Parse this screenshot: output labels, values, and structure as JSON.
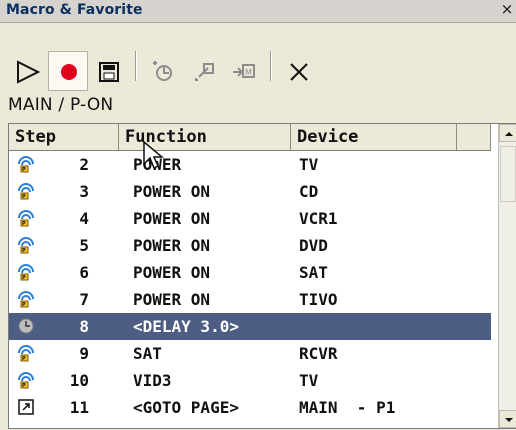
{
  "window": {
    "title": "Macro & Favorite",
    "close_label": "×"
  },
  "path": {
    "label": "MAIN / P-ON"
  },
  "table": {
    "headers": {
      "step": "Step",
      "function": "Function",
      "device": "Device"
    },
    "rows": [
      {
        "icon": "power-signal-icon",
        "step": "2",
        "function": "POWER",
        "device": "TV"
      },
      {
        "icon": "power-signal-icon",
        "step": "3",
        "function": "POWER ON",
        "device": "CD"
      },
      {
        "icon": "power-signal-icon",
        "step": "4",
        "function": "POWER ON",
        "device": "VCR1"
      },
      {
        "icon": "power-signal-icon",
        "step": "5",
        "function": "POWER ON",
        "device": "DVD"
      },
      {
        "icon": "power-signal-icon",
        "step": "6",
        "function": "POWER ON",
        "device": "SAT"
      },
      {
        "icon": "power-signal-icon",
        "step": "7",
        "function": "POWER ON",
        "device": "TIVO"
      },
      {
        "icon": "delay-clock-icon",
        "step": "8",
        "function": "<DELAY 3.0>",
        "device": "",
        "selected": true
      },
      {
        "icon": "power-signal-icon",
        "step": "9",
        "function": "SAT",
        "device": "RCVR"
      },
      {
        "icon": "power-signal-icon",
        "step": "10",
        "function": "VID3",
        "device": "TV"
      },
      {
        "icon": "goto-page-icon",
        "step": "11",
        "function": "<GOTO PAGE>",
        "device": "MAIN  - P1"
      }
    ]
  },
  "colors": {
    "title_text": "#0b2f5f",
    "selection": "#4d5d83",
    "record_red": "#e3001b"
  }
}
